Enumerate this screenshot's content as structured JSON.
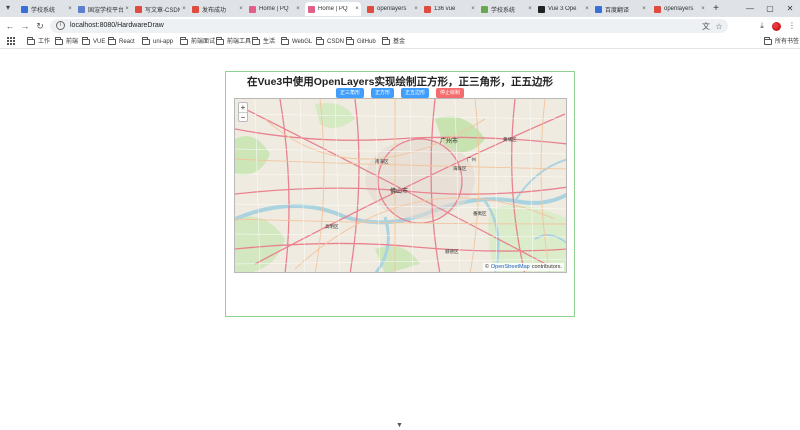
{
  "browser": {
    "tabs": [
      {
        "title": "学校系统",
        "color": "#3b6fd8",
        "active": false
      },
      {
        "title": "国渲学校平台",
        "color": "#5b7fcc",
        "active": false
      },
      {
        "title": "写文章-CSDN",
        "color": "#e04b3f",
        "active": false
      },
      {
        "title": "发布成功",
        "color": "#e04b3f",
        "active": false
      },
      {
        "title": "Home | PQ",
        "color": "#e0608a",
        "active": false
      },
      {
        "title": "Home | PQ",
        "color": "#e0608a",
        "active": true
      },
      {
        "title": "openlayers",
        "color": "#e04b3f",
        "active": false
      },
      {
        "title": "136 vue",
        "color": "#e04b3f",
        "active": false
      },
      {
        "title": "学校系统",
        "color": "#6aa84f",
        "active": false
      },
      {
        "title": "Vue 3 Ope",
        "color": "#222222",
        "active": false
      },
      {
        "title": "百度翻译",
        "color": "#3b6fd8",
        "active": false
      },
      {
        "title": "openlayers",
        "color": "#e04b3f",
        "active": false
      }
    ],
    "url": "localhost:8080/HardwareDraw",
    "bookmarks": [
      "工作",
      "前端",
      "VUE",
      "React",
      "uni-app",
      "前端面试",
      "前端工具",
      "生活",
      "WebGL",
      "CSDN",
      "GitHub",
      "基金"
    ],
    "all_bookmarks": "所有书签"
  },
  "page": {
    "title": "在Vue3中使用OpenLayers实现绘制正方形，正三角形，正五边形",
    "buttons": [
      {
        "label": "正三角形",
        "style": "blue"
      },
      {
        "label": "正方形",
        "style": "blue"
      },
      {
        "label": "正五边形",
        "style": "blue"
      },
      {
        "label": "停止绘制",
        "style": "red"
      }
    ],
    "map": {
      "zoom_in": "+",
      "zoom_out": "−",
      "attribution_symbol": "©",
      "attribution_link": "OpenStreetMap",
      "attribution_suffix": "contributors."
    }
  },
  "colors": {
    "frame_border": "#8fd18f",
    "button_blue": "#409eff",
    "button_red": "#f56c6c"
  }
}
